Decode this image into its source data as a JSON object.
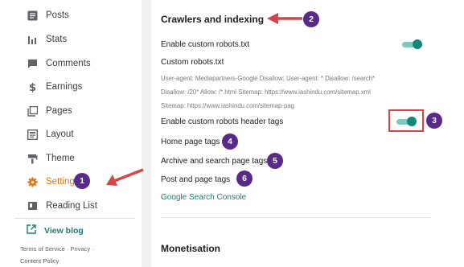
{
  "sidebar": {
    "items": [
      {
        "label": "Posts",
        "icon": "posts-icon"
      },
      {
        "label": "Stats",
        "icon": "stats-icon"
      },
      {
        "label": "Comments",
        "icon": "comments-icon"
      },
      {
        "label": "Earnings",
        "icon": "dollar-icon"
      },
      {
        "label": "Pages",
        "icon": "pages-icon"
      },
      {
        "label": "Layout",
        "icon": "layout-icon"
      },
      {
        "label": "Theme",
        "icon": "theme-icon"
      },
      {
        "label": "Settings",
        "icon": "gear-icon",
        "active": true
      },
      {
        "label": "Reading List",
        "icon": "bookmark-icon"
      }
    ],
    "view_blog": "View blog",
    "footer": {
      "terms": "Terms of Service",
      "sep": " · ",
      "privacy": "Privacy",
      "sep2": " ·",
      "content_policy": "Content Policy"
    }
  },
  "main": {
    "crawlers": {
      "title": "Crawlers and indexing",
      "enable_robots_txt": "Enable custom robots.txt",
      "custom_robots_label": "Custom robots.txt",
      "robots_lines": [
        "User-agent: Mediapartners-Google Disallow: User-agent: * Disallow: /search*",
        "Disallow: /20* Allow: /*.html Sitemap: https://www.iashindu.com/sitemap.xml",
        "Sitemap: https://www.iashindu.com/sitemap-pag"
      ],
      "enable_header_tags": "Enable custom robots header tags",
      "home_page_tags": "Home page tags",
      "archive_tags": "Archive and search page tags",
      "post_tags": "Post and page tags",
      "search_console": "Google Search Console"
    },
    "monetisation": {
      "title": "Monetisation"
    }
  },
  "annotations": {
    "badges": [
      "1",
      "2",
      "3",
      "4",
      "5",
      "6"
    ]
  },
  "colors": {
    "accent": "#11897a",
    "active_nav": "#e8710a",
    "badge": "#5a2a8a",
    "arrow": "#d64545"
  }
}
